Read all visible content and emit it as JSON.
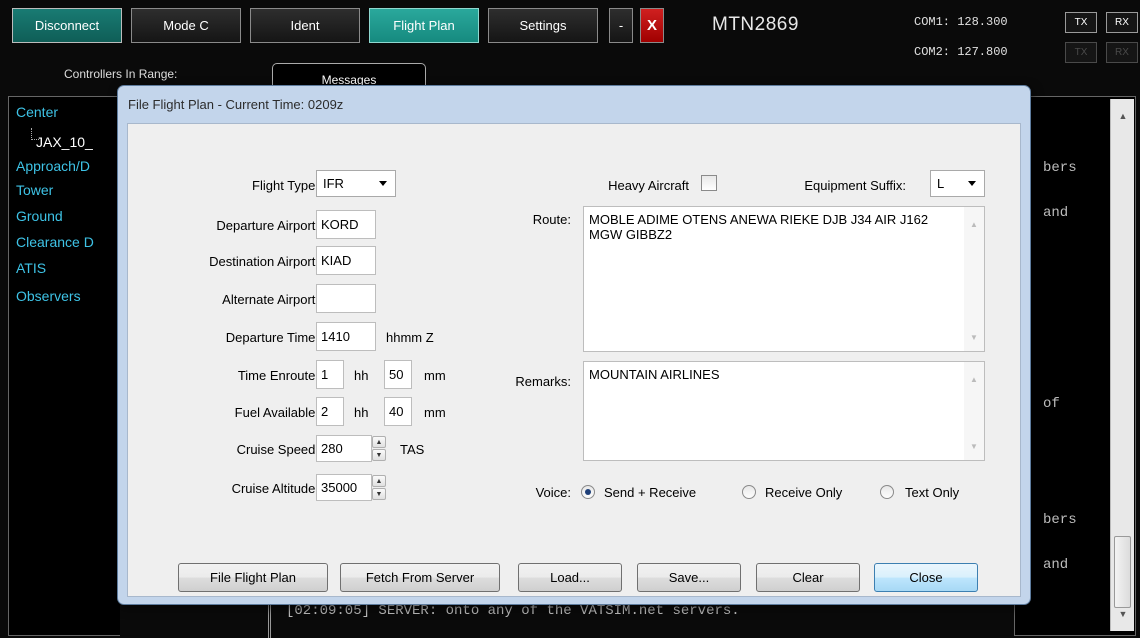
{
  "toolbar": {
    "disconnect": "Disconnect",
    "mode_c": "Mode C",
    "ident": "Ident",
    "flight_plan": "Flight Plan",
    "settings": "Settings",
    "minimize": "-",
    "close": "X",
    "callsign": "MTN2869"
  },
  "radios": {
    "com1": "COM1: 128.300",
    "com2": "COM2: 127.800",
    "tx": "TX",
    "rx": "RX"
  },
  "panel": {
    "controllers_label": "Controllers In Range:",
    "messages_tab": "Messages"
  },
  "tree": {
    "center": "Center",
    "center_child": "JAX_10_",
    "approach": "Approach/D",
    "tower": "Tower",
    "ground": "Ground",
    "clearance": "Clearance D",
    "atis": "ATIS",
    "observers": "Observers"
  },
  "messages": {
    "frag1": "bers",
    "frag2": "and",
    "frag3": "of",
    "frag4": "bers",
    "frag5": "and",
    "bottom": "[02:09:05] SERVER: onto any of the VATSIM.net servers."
  },
  "dialog": {
    "title": "File Flight Plan - Current Time: 0209z",
    "flight_type_label": "Flight Type:",
    "flight_type": "IFR",
    "departure_label": "Departure Airport:",
    "departure": "KORD",
    "destination_label": "Destination Airport:",
    "destination": "KIAD",
    "alternate_label": "Alternate Airport:",
    "alternate": "",
    "dep_time_label": "Departure Time:",
    "dep_time": "1410",
    "dep_time_unit": "hhmm Z",
    "enroute_label": "Time Enroute:",
    "enroute_hh": "1",
    "enroute_mm": "50",
    "fuel_label": "Fuel Available:",
    "fuel_hh": "2",
    "fuel_mm": "40",
    "hh": "hh",
    "mm": "mm",
    "speed_label": "Cruise Speed:",
    "speed": "280",
    "speed_unit": "TAS",
    "altitude_label": "Cruise Altitude:",
    "altitude": "35000",
    "heavy_label": "Heavy Aircraft",
    "equipment_label": "Equipment Suffix:",
    "equipment": "L",
    "route_label": "Route:",
    "route": "MOBLE ADIME OTENS ANEWA RIEKE DJB J34 AIR J162 MGW GIBBZ2",
    "remarks_label": "Remarks:",
    "remarks": "MOUNTAIN AIRLINES",
    "voice_label": "Voice:",
    "voice_send_receive": "Send + Receive",
    "voice_receive_only": "Receive Only",
    "voice_text_only": "Text Only",
    "voice_selected": "Send + Receive",
    "buttons": {
      "file": "File Flight Plan",
      "fetch": "Fetch From Server",
      "load": "Load...",
      "save": "Save...",
      "clear": "Clear",
      "close": "Close"
    }
  }
}
